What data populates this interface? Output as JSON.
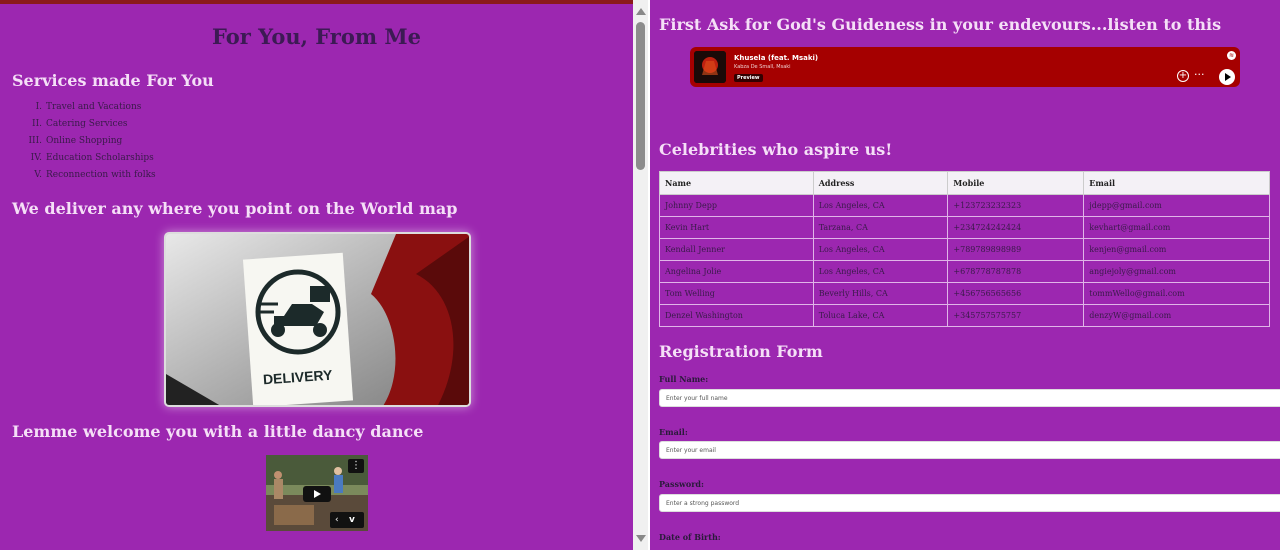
{
  "left": {
    "title": "For You, From Me",
    "services_heading": "Services made For You",
    "services": [
      {
        "num": "I.",
        "label": "Travel and Vacations"
      },
      {
        "num": "II.",
        "label": "Catering Services"
      },
      {
        "num": "III.",
        "label": "Online Shopping"
      },
      {
        "num": "IV.",
        "label": "Education Scholarships"
      },
      {
        "num": "V.",
        "label": "Reconnection with folks"
      }
    ],
    "deliver_heading": "We deliver any where you point on the World map",
    "delivery_image_text": "DELIVERY",
    "dance_heading": "Lemme welcome you with a little dancy dance"
  },
  "right": {
    "music_heading": "First Ask for God's Guideness in your endevours...listen to this",
    "player": {
      "track": "Khusela (feat. Msaki)",
      "artist": "Kabza De Small, Msaki",
      "badge": "Preview",
      "add_icon": "+",
      "more_icon": "···"
    },
    "celebs_heading": "Celebrities who aspire us!",
    "table": {
      "headers": [
        "Name",
        "Address",
        "Mobile",
        "Email"
      ],
      "rows": [
        [
          "Johnny Depp",
          "Los Angeles, CA",
          "+123723232323",
          "jdepp@gmail.com"
        ],
        [
          "Kevin Hart",
          "Tarzana, CA",
          "+234724242424",
          "kevhart@gmail.com"
        ],
        [
          "Kendall Jenner",
          "Los Angeles, CA",
          "+789789898989",
          "kenjen@gmail.com"
        ],
        [
          "Angelina Jolie",
          "Los Angeles, CA",
          "+678778787878",
          "angiejoly@gmail.com"
        ],
        [
          "Tom Welling",
          "Beverly Hills, CA",
          "+456756565656",
          "tommWello@gmail.com"
        ],
        [
          "Denzel Washington",
          "Toluca Lake, CA",
          "+345757575757",
          "denzyW@gmail.com"
        ]
      ]
    },
    "form": {
      "heading": "Registration Form",
      "full_name_label": "Full Name:",
      "full_name_placeholder": "Enter your full name",
      "email_label": "Email:",
      "email_placeholder": "Enter your email",
      "password_label": "Password:",
      "password_placeholder": "Enter a strong password",
      "dob_label": "Date of Birth:"
    }
  },
  "colors": {
    "page_purple": "#9c27b0",
    "player_red": "#a50000",
    "heading_light": "#f5dff7",
    "title_dark": "#3c1a54"
  }
}
